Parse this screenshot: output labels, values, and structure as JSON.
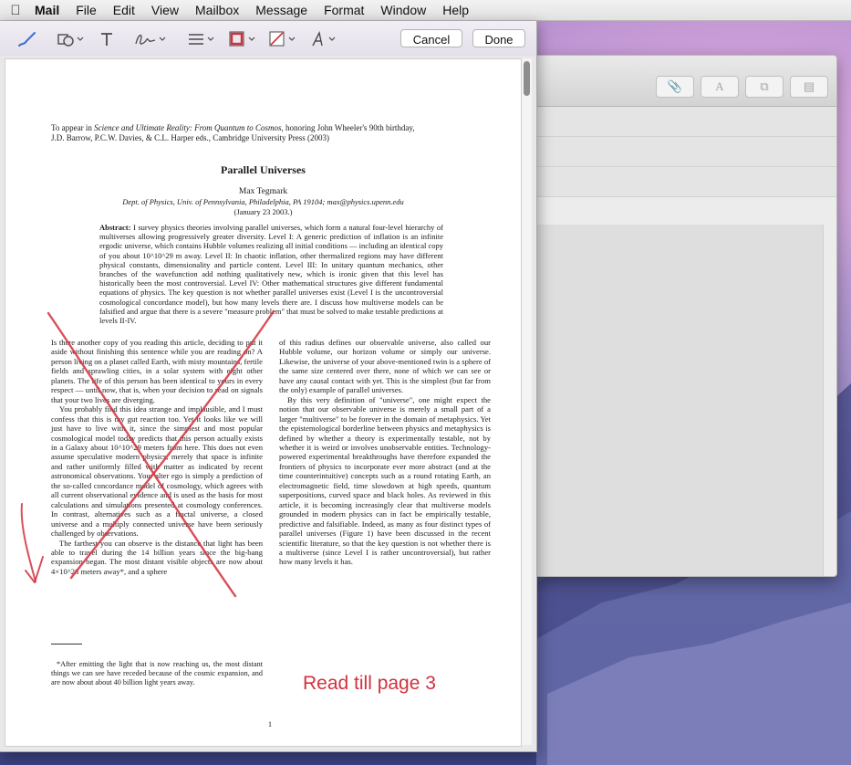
{
  "menubar": {
    "app_name": "Mail",
    "items": [
      "File",
      "Edit",
      "View",
      "Mailbox",
      "Message",
      "Format",
      "Window",
      "Help"
    ]
  },
  "background_window": {
    "toolbar_icons": [
      "paperclip-icon",
      "font-icon",
      "window-icon",
      "photo-browser-icon"
    ]
  },
  "markup_toolbar": {
    "tools": [
      "sketch-icon",
      "shapes-icon",
      "text-icon",
      "signature-icon",
      "line-style-icon",
      "border-color-icon",
      "fill-color-icon",
      "text-style-icon"
    ],
    "cancel_label": "Cancel",
    "done_label": "Done",
    "accent_color": "#d3303c"
  },
  "document": {
    "appear_line1_pre": "To appear in ",
    "appear_line1_em": "Science and Ultimate Reality: From Quantum to Cosmos,",
    "appear_line1_post": " honoring John Wheeler's 90th birthday,",
    "appear_line2": "J.D. Barrow, P.C.W. Davies, & C.L. Harper eds., Cambridge University Press (2003)",
    "title": "Parallel Universes",
    "author": "Max Tegmark",
    "affiliation": "Dept. of Physics, Univ. of Pennsylvania, Philadelphia, PA 19104; max@physics.upenn.edu",
    "date": "(January 23 2003.)",
    "abstract_label": "Abstract:",
    "abstract_text": "I survey physics theories involving parallel universes, which form a natural four-level hierarchy of multiverses allowing progressively greater diversity. Level I: A generic prediction of inflation is an infinite ergodic universe, which contains Hubble volumes realizing all initial conditions — including an identical copy of you about 10^10^29 m away. Level II: In chaotic inflation, other thermalized regions may have different physical constants, dimensionality and particle content. Level III: In unitary quantum mechanics, other branches of the wavefunction add nothing qualitatively new, which is ironic given that this level has historically been the most controversial. Level IV: Other mathematical structures give different fundamental equations of physics. The key question is not whether parallel universes exist (Level I is the uncontroversial cosmological concordance model), but how many levels there are. I discuss how multiverse models can be falsified and argue that there is a severe \"measure problem\" that must be solved to make testable predictions at levels II-IV.",
    "left_col_p1": "Is there another copy of you reading this article, deciding to put it aside without finishing this sentence while you are reading on? A person living on a planet called Earth, with misty mountains, fertile fields and sprawling cities, in a solar system with eight other planets. The life of this person has been identical to yours in every respect — until now, that is, when your decision to read on signals that your two lives are diverging.",
    "left_col_p2": "You probably find this idea strange and implausible, and I must confess that this is my gut reaction too. Yet it looks like we will just have to live with it, since the simplest and most popular cosmological model today predicts that this person actually exists in a Galaxy about 10^10^29 meters from here. This does not even assume speculative modern physics, merely that space is infinite and rather uniformly filled with matter as indicated by recent astronomical observations. Your alter ego is simply a prediction of the so-called concordance model of cosmology, which agrees with all current observational evidence and is used as the basis for most calculations and simulations presented at cosmology conferences. In contrast, alternatives such as a fractal universe, a closed universe and a multiply connected universe have been seriously challenged by observations.",
    "left_col_p3": "The farthest you can observe is the distance that light has been able to travel during the 14 billion years since the big-bang expansion began. The most distant visible objects are now about 4×10^26 meters away*, and a sphere",
    "right_col_p1": "of this radius defines our observable universe, also called our Hubble volume, our horizon volume or simply our universe. Likewise, the universe of your above-mentioned twin is a sphere of the same size centered over there, none of which we can see or have any causal contact with yet. This is the simplest (but far from the only) example of parallel universes.",
    "right_col_p2": "By this very definition of \"universe\", one might expect the notion that our observable universe is merely a small part of a larger \"multiverse\" to be forever in the domain of metaphysics. Yet the epistemological borderline between physics and metaphysics is defined by whether a theory is experimentally testable, not by whether it is weird or involves unobservable entities. Technology-powered experimental breakthroughs have therefore expanded the frontiers of physics to incorporate ever more abstract (and at the time counterintuitive) concepts such as a round rotating Earth, an electromagnetic field, time slowdown at high speeds, quantum superpositions, curved space and black holes. As reviewed in this article, it is becoming increasingly clear that multiverse models grounded in modern physics can in fact be empirically testable, predictive and falsifiable. Indeed, as many as four distinct types of parallel universes (Figure 1) have been discussed in the recent scientific literature, so that the key question is not whether there is a multiverse (since Level I is rather uncontroversial), but rather how many levels it has.",
    "footnote": "*After emitting the light that is now reaching us, the most distant things we can see have receded because of the cosmic expansion, and are now about about 40 billion light years away.",
    "page_number": "1"
  },
  "annotation": {
    "note": "Read till page 3",
    "color": "#d3303c"
  }
}
